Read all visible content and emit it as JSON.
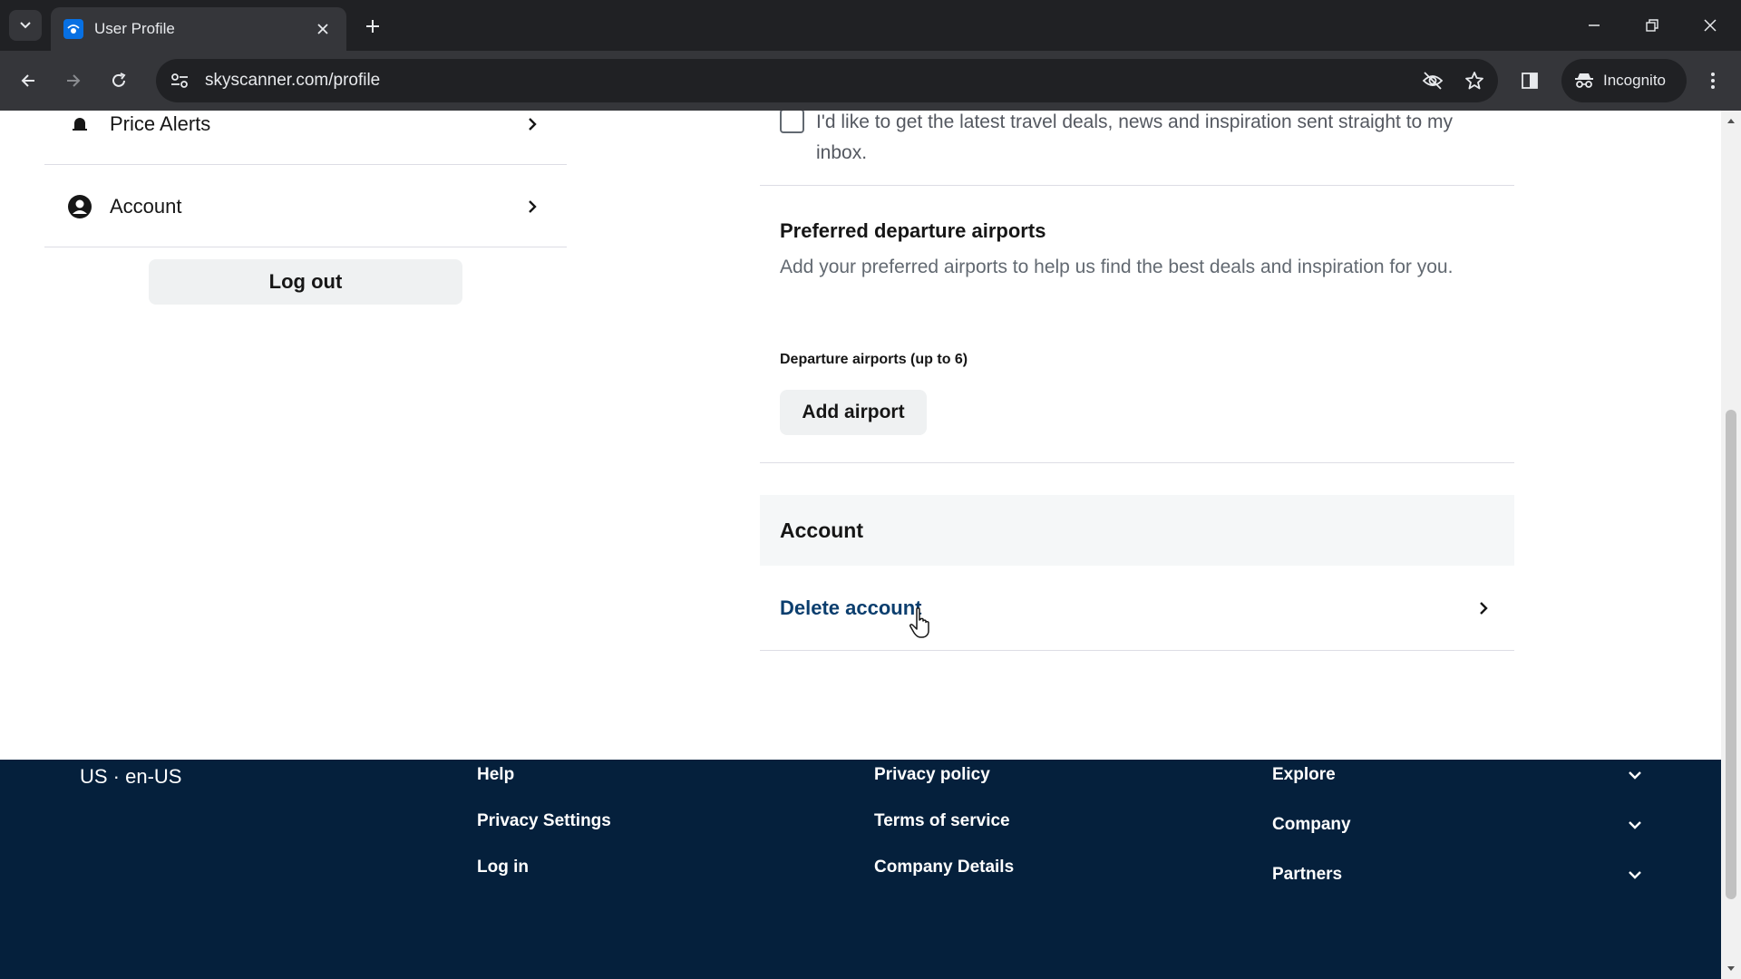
{
  "browser": {
    "tab_title": "User Profile",
    "url": "skyscanner.com/profile",
    "incognito_label": "Incognito"
  },
  "sidebar": {
    "items": [
      {
        "label": "Price Alerts",
        "icon": "bell-icon"
      },
      {
        "label": "Account",
        "icon": "user-circle-icon"
      }
    ],
    "logout_label": "Log out"
  },
  "main": {
    "newsletter_text": "I'd like to get the latest travel deals, news and inspiration sent straight to my inbox.",
    "newsletter_checked": false,
    "airports": {
      "title": "Preferred departure airports",
      "description": "Add your preferred airports to help us find the best deals and inspiration for you.",
      "field_label": "Departure airports (up to 6)",
      "add_button": "Add airport"
    },
    "account": {
      "title": "Account",
      "delete_label": "Delete account"
    }
  },
  "footer": {
    "locale": "US · en-US",
    "col1": [
      "Help",
      "Privacy Settings",
      "Log in"
    ],
    "col2": [
      "Privacy policy",
      "Terms of service",
      "Company Details"
    ],
    "accordions": [
      "Explore",
      "Company",
      "Partners"
    ]
  },
  "colors": {
    "footer_bg": "#05203c",
    "link_blue": "#0b3e6e",
    "button_bg": "#eff1f2"
  }
}
